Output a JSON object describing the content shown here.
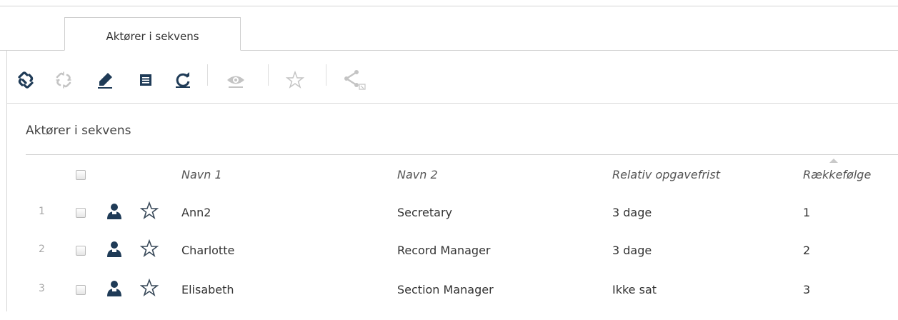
{
  "tab": {
    "label": "Aktører i sekvens"
  },
  "toolbar": {
    "buttons": [
      {
        "icon": "link-icon",
        "enabled": true
      },
      {
        "icon": "unlink-icon",
        "enabled": false
      },
      {
        "icon": "pencil-icon",
        "enabled": true
      },
      {
        "icon": "details-icon",
        "enabled": true
      },
      {
        "icon": "refresh-icon",
        "enabled": true
      },
      {
        "icon": "eye-icon",
        "enabled": false
      },
      {
        "icon": "star-icon",
        "enabled": false
      },
      {
        "icon": "share-icon",
        "enabled": false
      }
    ]
  },
  "section": {
    "title": "Aktører i sekvens"
  },
  "table": {
    "columns": [
      "Navn 1",
      "Navn 2",
      "Relativ opgavefrist",
      "Rækkefølge"
    ],
    "sorted_column": "Rækkefølge",
    "rows": [
      {
        "num": "1",
        "navn1": "Ann2",
        "navn2": "Secretary",
        "frist": "3 dage",
        "order": "1"
      },
      {
        "num": "2",
        "navn1": "Charlotte",
        "navn2": "Record Manager",
        "frist": "3 dage",
        "order": "2"
      },
      {
        "num": "3",
        "navn1": "Elisabeth",
        "navn2": "Section Manager",
        "frist": "Ikke sat",
        "order": "3"
      }
    ]
  },
  "colors": {
    "icon_dark": "#1f3b57",
    "icon_disabled": "#c4c4c4"
  }
}
